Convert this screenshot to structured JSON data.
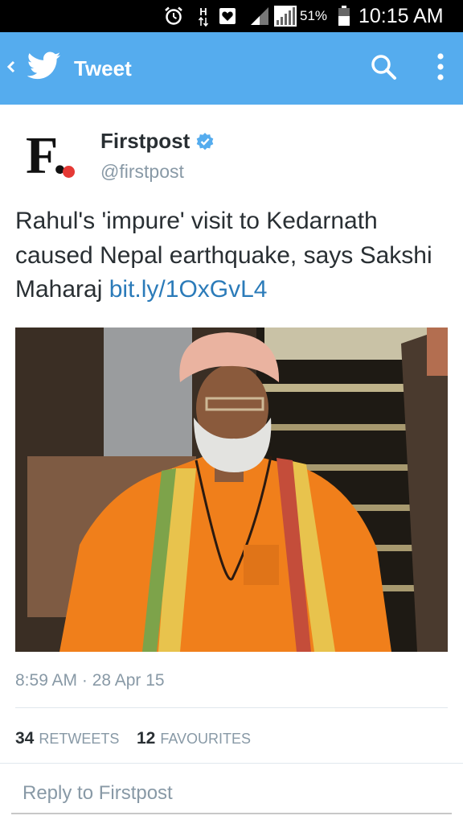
{
  "status_bar": {
    "battery": "51%",
    "time": "10:15 AM",
    "network": "H"
  },
  "app_bar": {
    "title": "Tweet",
    "icons": {
      "back": "chevron-left-icon",
      "logo": "twitter-bird-icon",
      "search": "search-icon",
      "overflow": "more-vert-icon"
    }
  },
  "tweet": {
    "author_logo_letter": "F.",
    "author_name": "Firstpost",
    "author_handle": "@firstpost",
    "verified": true,
    "text": "Rahul's 'impure' visit to Kedarnath caused Nepal earthquake, says Sakshi Maharaj",
    "link": "bit.ly/1OxGvL4",
    "timestamp": "8:59 AM · 28 Apr 15",
    "retweets_count": "34",
    "retweets_label": "RETWEETS",
    "favourites_count": "12",
    "favourites_label": "FAVOURITES"
  },
  "reply": {
    "placeholder": "Reply to Firstpost"
  },
  "colors": {
    "accent": "#55acee",
    "link": "#2b7bb9",
    "status_bar": "#000000",
    "secondary_text": "#8899a6",
    "logo_dot": "#e53935"
  }
}
